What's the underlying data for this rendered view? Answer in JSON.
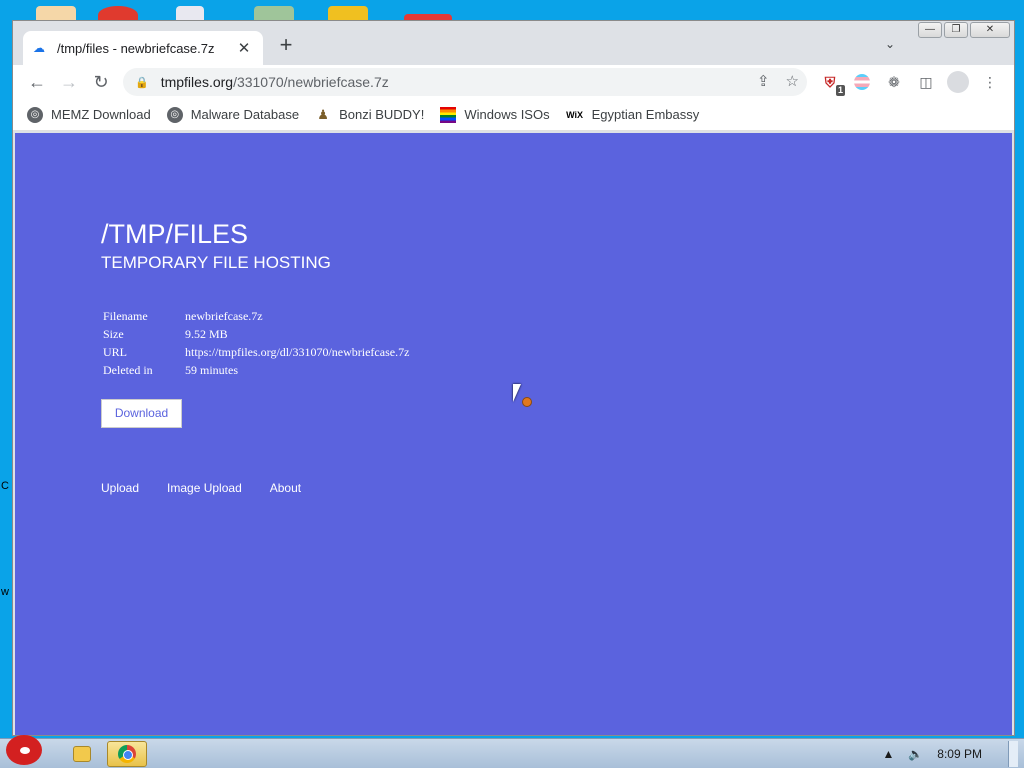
{
  "browser": {
    "tab": {
      "title": "/tmp/files - newbriefcase.7z"
    },
    "url": {
      "host": "tmpfiles.org",
      "path": "/331070/newbriefcase.7z"
    },
    "ext_badge": "1",
    "bookmarks": [
      {
        "label": "MEMZ Download",
        "icon": "globe-icon"
      },
      {
        "label": "Malware Database",
        "icon": "globe-icon"
      },
      {
        "label": "Bonzi BUDDY!",
        "icon": "bonzi-icon"
      },
      {
        "label": "Windows ISOs",
        "icon": "rainbow-flag-icon"
      },
      {
        "label": "Egyptian Embassy",
        "icon": "wix-icon"
      }
    ],
    "wix_text": "WiX"
  },
  "page": {
    "title": "/TMP/FILES",
    "subtitle": "TEMPORARY FILE HOSTING",
    "info": [
      {
        "key": "Filename",
        "value": "newbriefcase.7z"
      },
      {
        "key": "Size",
        "value": "9.52 MB"
      },
      {
        "key": "URL",
        "value": "https://tmpfiles.org/dl/331070/newbriefcase.7z"
      },
      {
        "key": "Deleted in",
        "value": "59 minutes"
      }
    ],
    "download_label": "Download",
    "links": [
      "Upload",
      "Image Upload",
      "About"
    ]
  },
  "taskbar": {
    "time": "8:09 PM"
  },
  "colors": {
    "page_bg": "#5b63de",
    "desktop_bg": "#0aa3e8"
  }
}
